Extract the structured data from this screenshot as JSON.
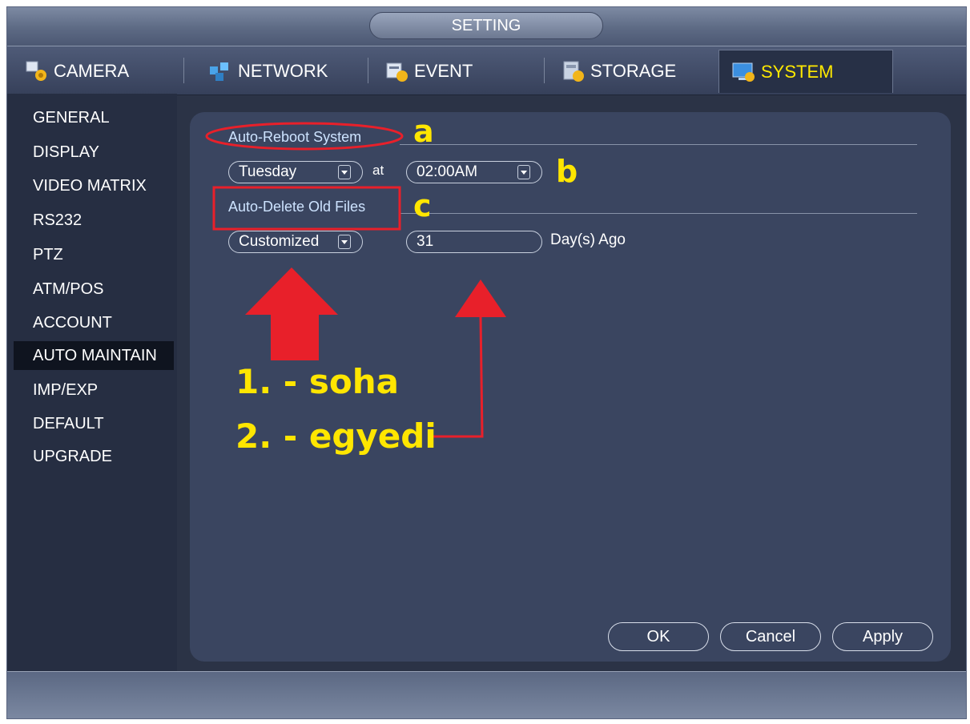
{
  "window": {
    "title": "SETTING"
  },
  "tabs": [
    {
      "label": "CAMERA",
      "icon": "camera-gear-icon"
    },
    {
      "label": "NETWORK",
      "icon": "network-icon"
    },
    {
      "label": "EVENT",
      "icon": "event-icon"
    },
    {
      "label": "STORAGE",
      "icon": "storage-icon"
    },
    {
      "label": "SYSTEM",
      "icon": "system-monitor-icon",
      "active": true
    }
  ],
  "sidebar": {
    "items": [
      {
        "label": "GENERAL"
      },
      {
        "label": "DISPLAY"
      },
      {
        "label": "VIDEO MATRIX"
      },
      {
        "label": "RS232"
      },
      {
        "label": "PTZ"
      },
      {
        "label": "ATM/POS"
      },
      {
        "label": "ACCOUNT"
      },
      {
        "label": "AUTO MAINTAIN",
        "active": true
      },
      {
        "label": "IMP/EXP"
      },
      {
        "label": "DEFAULT"
      },
      {
        "label": "UPGRADE"
      }
    ]
  },
  "auto_reboot": {
    "title": "Auto-Reboot System",
    "day": "Tuesday",
    "at_label": "at",
    "time": "02:00AM"
  },
  "auto_delete": {
    "title": "Auto-Delete Old Files",
    "mode": "Customized",
    "days": "31",
    "days_suffix": "Day(s) Ago"
  },
  "buttons": {
    "ok": "OK",
    "cancel": "Cancel",
    "apply": "Apply"
  },
  "annotations": {
    "a": "a",
    "b": "b",
    "c": "c",
    "line1": "1. - soha",
    "line2": "2. - egyedi"
  },
  "colors": {
    "accent_active_tab": "#ffe900",
    "section_title": "#cde3ff",
    "annotation_text": "#ffe600",
    "annotation_marks": "#e8202a"
  }
}
